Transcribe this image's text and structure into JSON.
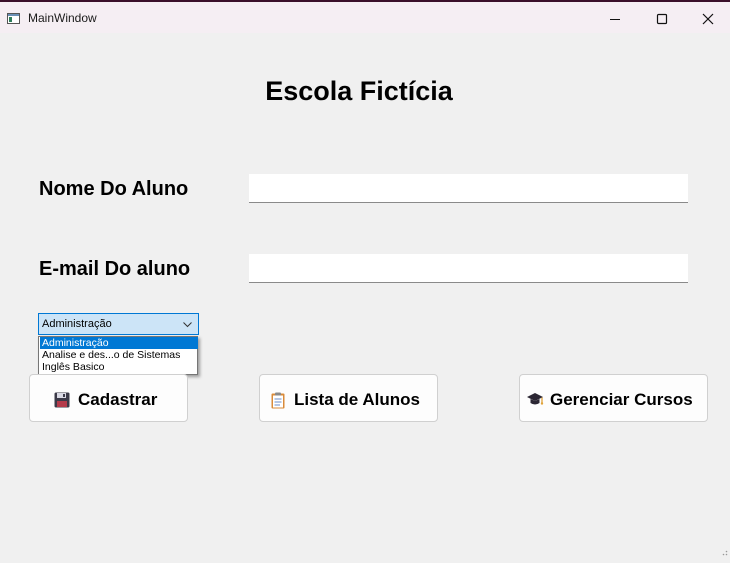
{
  "window": {
    "title": "MainWindow",
    "icon": "app-window-icon"
  },
  "header": {
    "title": "Escola Fictícia"
  },
  "form": {
    "name_label": "Nome Do Aluno",
    "name_value": "",
    "email_label": "E-mail Do aluno",
    "email_value": ""
  },
  "course_select": {
    "selected": "Administração",
    "options": [
      "Administração",
      "Analise e des...o de Sistemas",
      "Inglês Basico"
    ],
    "highlight_color": "#0078d4"
  },
  "buttons": {
    "cadastrar": {
      "label": "Cadastrar",
      "icon": "floppy-disk-icon"
    },
    "lista": {
      "label": "Lista de Alunos",
      "icon": "clipboard-icon"
    },
    "cursos": {
      "label": "Gerenciar Cursos",
      "icon": "graduation-cap-icon"
    }
  }
}
